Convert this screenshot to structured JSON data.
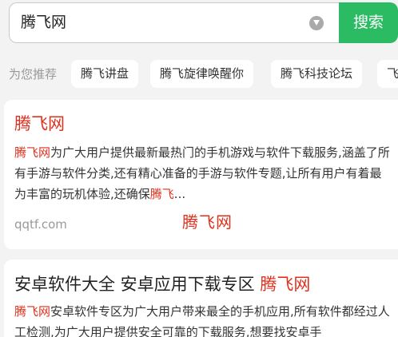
{
  "search": {
    "query": "腾飞网",
    "button_label": "搜索"
  },
  "recommend": {
    "label": "为您推荐",
    "chips": [
      "腾飞讲盘",
      "腾飞旋律唤醒你",
      "腾飞科技论坛",
      "飞"
    ]
  },
  "results": [
    {
      "title": "腾飞网",
      "desc_highlight": "腾飞网",
      "desc_text": "为广大用户提供最新最热门的手机游戏与软件下载服务,涵盖了所有手游与软件分类,还有精心准备的手游与软件专题,让所有用户有着最为丰富的玩机体验,还确保",
      "desc_highlight_tail": "腾飞",
      "desc_ellipsis": "...",
      "source": "qqtf.com",
      "watermark": "腾飞网"
    },
    {
      "title_text": "安卓软件大全 安卓应用下载专区 ",
      "title_highlight": "腾飞网",
      "desc_highlight": "腾飞网",
      "desc_text": "安卓软件专区为广大用户带来最全的手机应用,所有软件都经过人工检测,为广大用户提供安全可靠的下载服务,想要找安卓手"
    }
  ]
}
